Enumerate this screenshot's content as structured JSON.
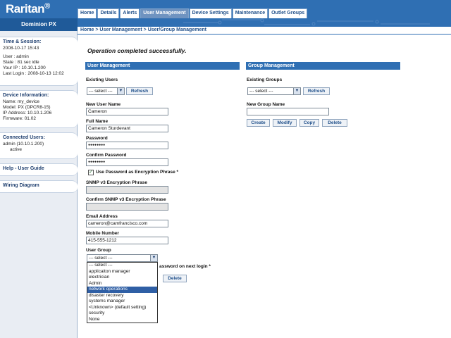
{
  "brand": {
    "logo": "Raritan",
    "logo_mark": "®",
    "product": "Dominion PX"
  },
  "nav": {
    "tabs": [
      {
        "label": "Home"
      },
      {
        "label": "Details"
      },
      {
        "label": "Alerts"
      },
      {
        "label": "User Management"
      },
      {
        "label": "Device Settings"
      },
      {
        "label": "Maintenance"
      },
      {
        "label": "Outlet Groups"
      }
    ],
    "active_tab": 3,
    "breadcrumb": "Home > User Management > User/Group Management"
  },
  "sidebar": {
    "time_session": {
      "heading": "Time & Session:",
      "datetime": "2008-10-17 15:43",
      "user": "User : admin",
      "state": "State : 81 sec idle",
      "ip": "Your IP : 10.10.1.200",
      "last_login": "Last Login : 2008-10-13 12:02"
    },
    "device_info": {
      "heading": "Device Information:",
      "name": "Name: my_device",
      "model": "Model: PX (DPCR8-15)",
      "ip": "IP Address: 10.10.1.206",
      "firmware": "Firmware: 01.02"
    },
    "connected_users": {
      "heading": "Connected Users:",
      "user": "admin (10.10.1.200)",
      "status": "active"
    },
    "help_link": "Help - User Guide",
    "wiring_link": "Wiring Diagram"
  },
  "status_message": "Operation completed successfully.",
  "user_mgmt": {
    "heading": "User Management",
    "existing_users_label": "Existing Users",
    "existing_users_value": "--- select ---",
    "refresh_label": "Refresh",
    "new_user_name_label": "New User Name",
    "new_user_name_value": "Cameron",
    "full_name_label": "Full Name",
    "full_name_value": "Cameron Sturdevant",
    "password_label": "Password",
    "password_value": "●●●●●●●●",
    "confirm_password_label": "Confirm Password",
    "confirm_password_value": "●●●●●●●●",
    "encryption_checkbox_label": "Use Password as Encryption Phrase *",
    "encryption_checked": true,
    "snmp_label": "SNMP v3 Encryption Phrase",
    "snmp_confirm_label": "Confirm SNMP v3 Encryption Phrase",
    "email_label": "Email Address",
    "email_value": "cameron@camfrancisco.com",
    "mobile_label": "Mobile Number",
    "mobile_value": "415-555-1212",
    "user_group_label": "User Group",
    "user_group_value": "--- select ---",
    "user_group_options": [
      "--- select ---",
      "applicaiton manager",
      "electrician",
      "Admin",
      "network operations",
      "disaster recovery",
      "systems manager",
      "<Unknown> (default setting)",
      "security",
      "None"
    ],
    "highlighted_option": 4,
    "password_next_login_label": "assword on next login *",
    "delete_label": "Delete"
  },
  "group_mgmt": {
    "heading": "Group Management",
    "existing_groups_label": "Existing Groups",
    "existing_groups_value": "--- select ---",
    "refresh_label": "Refresh",
    "new_group_name_label": "New Group Name",
    "new_group_name_value": "",
    "create_label": "Create",
    "modify_label": "Modify",
    "copy_label": "Copy",
    "delete_label": "Delete"
  },
  "colors": {
    "brand_blue": "#2f6fb3",
    "brand_dark": "#1f5a99",
    "active_tab": "#6f93c0",
    "highlight": "#2f5fa5"
  },
  "icons": {
    "dropdown": "chevron-down-icon",
    "checkbox": "checkmark-icon"
  }
}
